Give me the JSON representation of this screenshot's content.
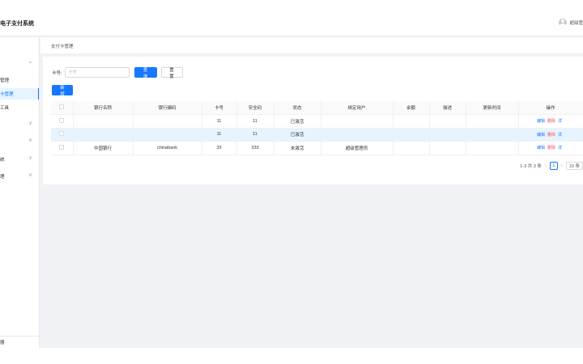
{
  "header": {
    "title": "电子支付系统",
    "user": "超级管"
  },
  "sidebar": {
    "items": [
      {
        "label": "",
        "chevron": "^"
      },
      {
        "label": "管理"
      },
      {
        "label": "卡管理"
      },
      {
        "label": "工具"
      },
      {
        "label": "",
        "chevron": "v"
      },
      {
        "label": "",
        "chevron": "v"
      },
      {
        "label": "统",
        "chevron": "v"
      },
      {
        "label": "理",
        "chevron": "v"
      }
    ],
    "footer": "器"
  },
  "breadcrumb": "支付卡管理",
  "search": {
    "label": "卡号:",
    "placeholder": "卡号",
    "query_label": "查 询",
    "reset_label": "重 置"
  },
  "toolbar": {
    "add_label": "新增"
  },
  "table": {
    "headers": [
      "",
      "银行名称",
      "银行编码",
      "卡号",
      "安全码",
      "状态",
      "绑定用户",
      "余额",
      "描述",
      "更新时间",
      "操作"
    ],
    "rows": [
      [
        "",
        "",
        "",
        "11",
        "11",
        "已激活",
        "",
        "",
        "",
        "",
        ""
      ],
      [
        "",
        "",
        "",
        "11",
        "11",
        "已激活",
        "",
        "",
        "",
        "",
        ""
      ],
      [
        "",
        "中国银行",
        "chinabank",
        "33",
        "333",
        "未激活",
        "超级管理员",
        "",
        "",
        "",
        ""
      ]
    ],
    "ops": {
      "edit": "编辑",
      "delete": "删除",
      "more": "详"
    }
  },
  "pagination": {
    "summary": "1-3 共 3 条",
    "prev": "‹",
    "page": "1",
    "next": "›",
    "size": "10 条"
  },
  "colors": {
    "primary": "#1677ff",
    "danger": "#ff4d4f",
    "highlight": "#e6f4ff"
  }
}
